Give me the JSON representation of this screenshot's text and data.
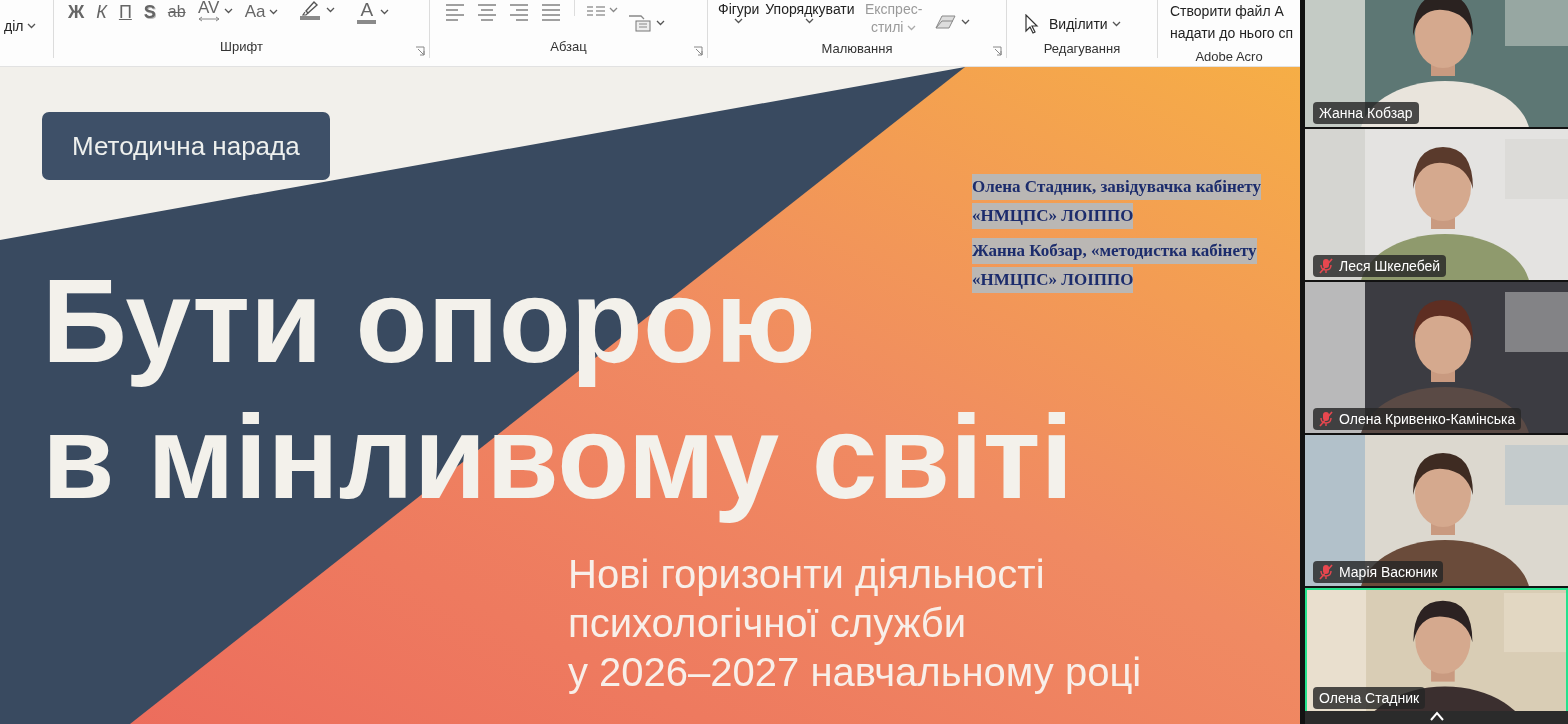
{
  "ribbon": {
    "groups": [
      {
        "items": [
          {
            "kind": "inline",
            "label": "діл",
            "dropdown": true
          }
        ]
      },
      {
        "label": "Шрифт",
        "launcher": true,
        "items": [
          {
            "kind": "bold",
            "label": "Ж",
            "dropdown": false
          },
          {
            "kind": "italic",
            "label": "К",
            "dropdown": false
          },
          {
            "kind": "underline",
            "label": "П",
            "dropdown": false
          },
          {
            "kind": "shadow",
            "label": "S",
            "dropdown": false
          },
          {
            "kind": "strike",
            "label": "ab",
            "dropdown": false
          },
          {
            "kind": "spacing",
            "label": "AV",
            "dropdown": true
          },
          {
            "kind": "case",
            "label": "Aa",
            "dropdown": true
          },
          {
            "kind": "highlight",
            "dropdown": true
          },
          {
            "kind": "fontcolor",
            "label": "A",
            "dropdown": true
          }
        ]
      },
      {
        "label": "Абзац",
        "launcher": true,
        "items": [
          {
            "kind": "align-left",
            "dropdown": false
          },
          {
            "kind": "align-center",
            "dropdown": false
          },
          {
            "kind": "align-right",
            "dropdown": false
          },
          {
            "kind": "justify",
            "dropdown": false
          },
          {
            "kind": "columns",
            "dropdown": true
          },
          {
            "kind": "textbox",
            "dropdown": true
          }
        ]
      },
      {
        "label": "Малювання",
        "launcher": true,
        "items": [
          {
            "kind": "large",
            "label": "Фігури",
            "dropdown": true,
            "disabled": false
          },
          {
            "kind": "large",
            "label": "Упорядкувати",
            "dropdown": true,
            "disabled": false
          },
          {
            "kind": "large",
            "label": "Експрес-стилі",
            "dropdown": true,
            "disabled": true
          },
          {
            "kind": "eraser",
            "dropdown": true
          }
        ]
      },
      {
        "label": "Редагування",
        "launcher": false,
        "items": [
          {
            "kind": "select",
            "label": "Виділити",
            "dropdown": true
          }
        ]
      },
      {
        "label": "Adobe Acro",
        "launcher": false,
        "items": [
          {
            "kind": "create",
            "lines": [
              "Створити файл А",
              "надати до нього сп"
            ]
          }
        ]
      }
    ]
  },
  "slide": {
    "badge": "Методична нарада",
    "title_lines": [
      "Бути опорою",
      "в мінливому світі"
    ],
    "subtitle_lines": [
      "Нові горизонти діяльності",
      "психологічної служби",
      "у 2026–2027 навчальному році"
    ],
    "notes": [
      {
        "lines": [
          "Олена Стадник, завідувачка кабінету",
          "«НМЦПС» ЛОІППО"
        ]
      },
      {
        "lines": [
          "Жанна Кобзар, «методистка кабінету",
          "«НМЦПС» ЛОІППО"
        ]
      }
    ]
  },
  "participants": [
    {
      "name": "Жанна Кобзар",
      "muted": false,
      "selected": false
    },
    {
      "name": "Леся Шкелебей",
      "muted": true,
      "selected": false
    },
    {
      "name": "Олена Кривенко-Камінська",
      "muted": true,
      "selected": false
    },
    {
      "name": "Марія Васюник",
      "muted": true,
      "selected": false
    },
    {
      "name": "Олена Стадник",
      "muted": false,
      "selected": true
    }
  ]
}
